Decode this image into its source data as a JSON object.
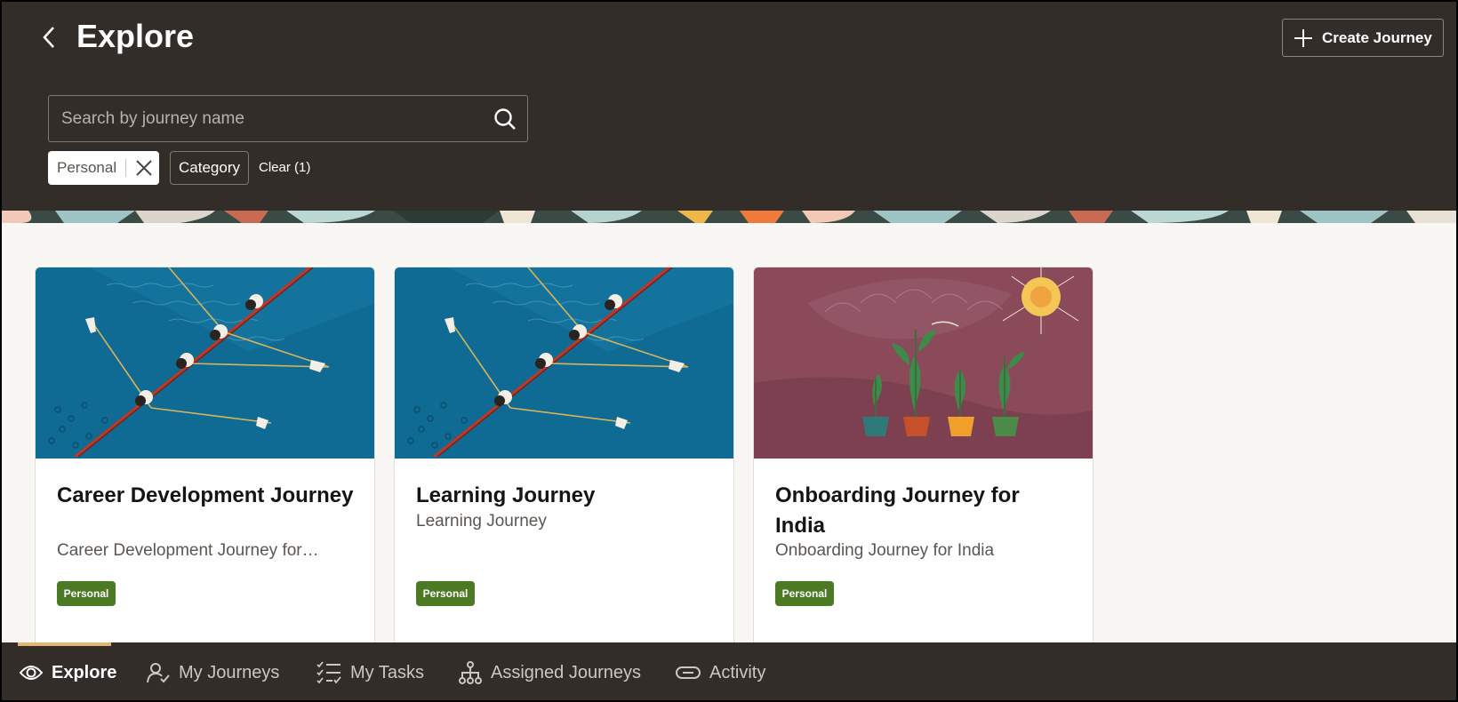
{
  "header": {
    "title": "Explore",
    "back_icon": "chevron-left-icon",
    "create_button_label": "Create Journey",
    "create_icon": "plus-icon"
  },
  "search": {
    "placeholder": "Search by journey name",
    "value": "",
    "icon": "search-icon"
  },
  "filters": {
    "chips": [
      {
        "label": "Personal",
        "removable": true
      }
    ],
    "category_label": "Category",
    "clear_label": "Clear (1)"
  },
  "cards": [
    {
      "title": "Career Development Journey",
      "description": "Career Development Journey for…",
      "badge": "Personal",
      "image": "rowing-boat-illustration"
    },
    {
      "title": "Learning Journey",
      "description": "Learning Journey",
      "badge": "Personal",
      "image": "rowing-boat-illustration"
    },
    {
      "title": "Onboarding Journey for India",
      "description": "Onboarding Journey for India",
      "badge": "Personal",
      "image": "potted-plants-sun-illustration"
    }
  ],
  "bottom_nav": {
    "items": [
      {
        "label": "Explore",
        "icon": "eye-icon",
        "active": true
      },
      {
        "label": "My Journeys",
        "icon": "user-check-icon",
        "active": false
      },
      {
        "label": "My Tasks",
        "icon": "checklist-icon",
        "active": false
      },
      {
        "label": "Assigned Journeys",
        "icon": "hierarchy-icon",
        "active": false
      },
      {
        "label": "Activity",
        "icon": "link-icon",
        "active": false
      }
    ]
  },
  "colors": {
    "header_bg": "#322d29",
    "content_bg": "#f9f7f4",
    "badge_green": "#4c7a24",
    "nav_indicator": "#e2b66c",
    "rowing_water": "#0f6a94",
    "plants_bg": "#8a4a5a"
  }
}
